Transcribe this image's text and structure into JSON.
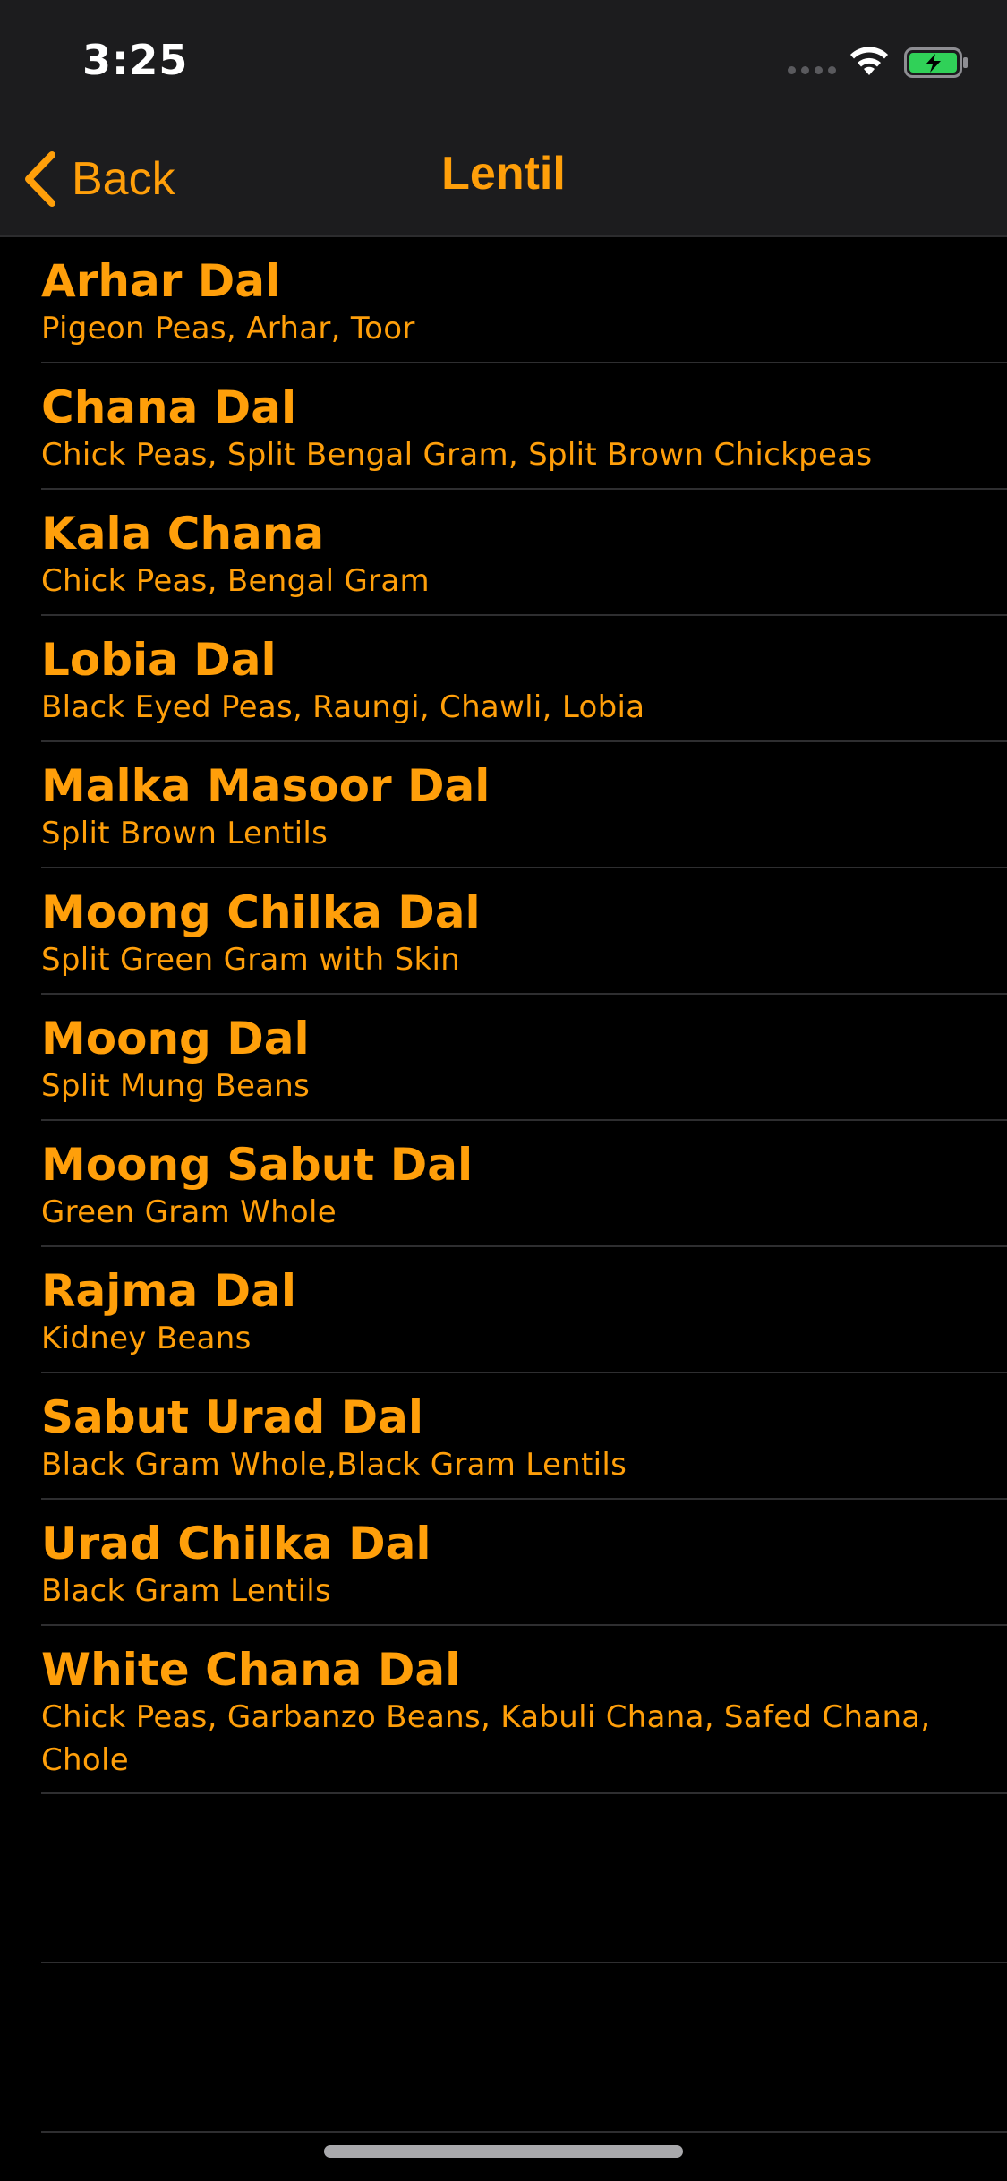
{
  "status_bar": {
    "time": "3:25"
  },
  "nav": {
    "back_label": "Back",
    "title": "Lentil"
  },
  "colors": {
    "accent": "#ff9f0a",
    "background": "#000000",
    "nav_background": "#1c1c1e",
    "battery_green": "#30d158"
  },
  "lentils": [
    {
      "name": "Arhar Dal",
      "aliases": "Pigeon Peas, Arhar, Toor"
    },
    {
      "name": "Chana Dal",
      "aliases": "Chick Peas, Split Bengal Gram, Split Brown Chickpeas"
    },
    {
      "name": "Kala Chana",
      "aliases": "Chick Peas, Bengal Gram"
    },
    {
      "name": "Lobia Dal",
      "aliases": "Black Eyed Peas, Raungi, Chawli, Lobia"
    },
    {
      "name": "Malka Masoor Dal",
      "aliases": "Split Brown Lentils"
    },
    {
      "name": "Moong Chilka Dal",
      "aliases": "Split Green Gram with Skin"
    },
    {
      "name": "Moong Dal",
      "aliases": "Split Mung Beans"
    },
    {
      "name": "Moong Sabut Dal",
      "aliases": "Green Gram Whole"
    },
    {
      "name": "Rajma Dal",
      "aliases": "Kidney Beans"
    },
    {
      "name": "Sabut Urad Dal",
      "aliases": "Black Gram Whole,Black Gram Lentils"
    },
    {
      "name": "Urad Chilka Dal",
      "aliases": "Black Gram Lentils"
    },
    {
      "name": "White Chana Dal",
      "aliases": "Chick Peas, Garbanzo Beans, Kabuli Chana, Safed Chana, Chole"
    }
  ]
}
